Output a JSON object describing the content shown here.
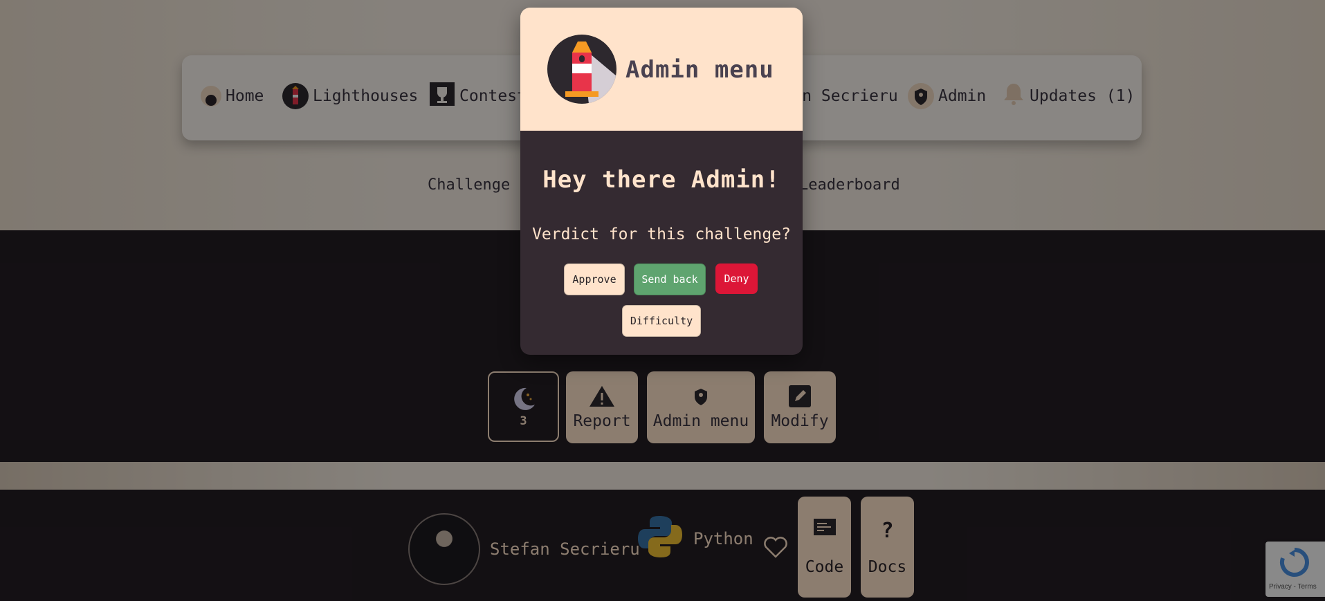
{
  "nav": {
    "items": [
      {
        "label": "Home"
      },
      {
        "label": "Lighthouses"
      },
      {
        "label": "Contests"
      },
      {
        "label": "Stefan Secrieru"
      },
      {
        "label": "Admin"
      },
      {
        "label": "Updates (1)"
      }
    ]
  },
  "subnav": {
    "left_tab": "Challenge",
    "right_tab": "Leaderboard"
  },
  "actions": {
    "theme_count": "3",
    "report_label": "Report",
    "admin_menu_label": "Admin menu",
    "modify_label": "Modify"
  },
  "footer": {
    "author_name": "Stefan Secrieru",
    "language": "Python",
    "code_label": "Code",
    "docs_label": "Docs"
  },
  "recaptcha": {
    "terms": "Privacy - Terms"
  },
  "modal": {
    "title": "Admin menu",
    "greeting": "Hey there Admin!",
    "question": "Verdict for this challenge?",
    "approve_label": "Approve",
    "send_back_label": "Send back",
    "deny_label": "Deny",
    "difficulty_label": "Difficulty"
  },
  "colors": {
    "accent_cream": "#ffe3cb",
    "send_back_green": "#5fa46f",
    "deny_red": "#dc1637",
    "dark_panel": "#342a31"
  }
}
